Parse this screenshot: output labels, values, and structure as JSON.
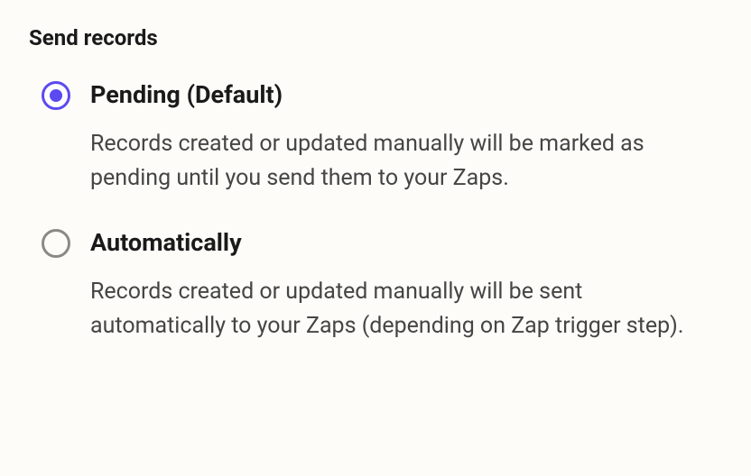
{
  "section": {
    "title": "Send records"
  },
  "options": {
    "pending": {
      "label": "Pending (Default)",
      "description": "Records created or updated manually will be marked as pending until you send them to your Zaps.",
      "selected": true
    },
    "automatically": {
      "label": "Automatically",
      "description": "Records created or updated manually will be sent automatically to your Zaps (depending on Zap trigger step).",
      "selected": false
    }
  }
}
